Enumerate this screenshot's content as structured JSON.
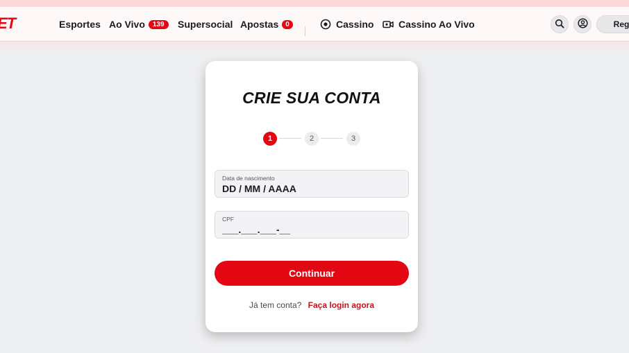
{
  "header": {
    "logo_text": "ET",
    "nav": {
      "esportes": "Esportes",
      "ao_vivo": "Ao Vivo",
      "ao_vivo_count": "139",
      "supersocial": "Supersocial",
      "apostas": "Apostas",
      "apostas_count": "0",
      "cassino": "Cassino",
      "cassino_ao_vivo": "Cassino Ao Vivo"
    },
    "actions": {
      "search_icon": "search-icon",
      "account_icon": "user-icon",
      "register_label": "Registrar"
    }
  },
  "form": {
    "title": "CRIE SUA CONTA",
    "steps": [
      {
        "label": "1",
        "active": true
      },
      {
        "label": "2",
        "active": false
      },
      {
        "label": "3",
        "active": false
      }
    ],
    "birthdate": {
      "label": "Data de nascimento",
      "value": "DD / MM / AAAA"
    },
    "cpf": {
      "label": "CPF",
      "value": "___.___.___-__"
    },
    "continue_label": "Continuar",
    "login_question": "Já tem conta?",
    "login_link": "Faça login agora"
  },
  "colors": {
    "brand_red": "#e30613",
    "link_red": "#c4121c",
    "page_bg": "#eeeff1"
  }
}
